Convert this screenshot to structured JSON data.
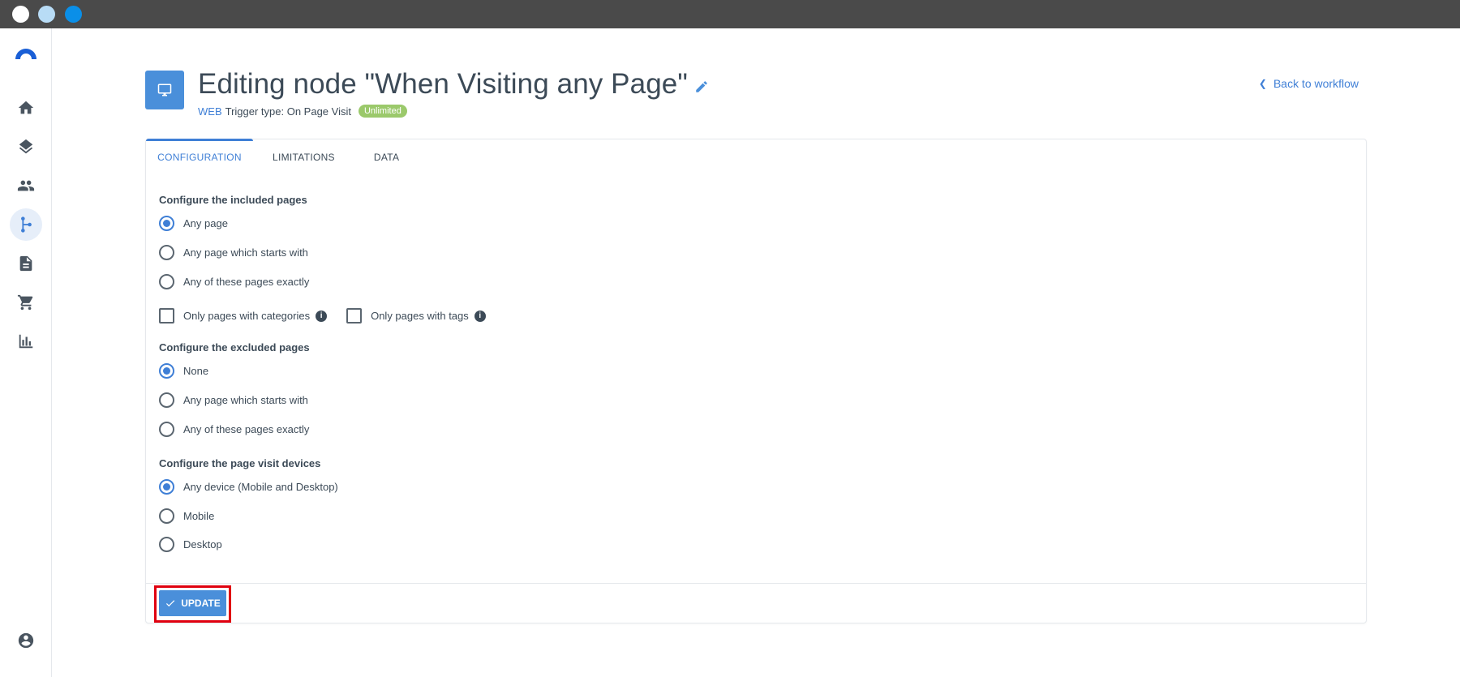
{
  "header": {
    "title": "Editing node \"When Visiting any Page\"",
    "channel": "WEB",
    "trigger_type": "Trigger type: On Page Visit",
    "badge": "Unlimited",
    "back_link": "Back to workflow"
  },
  "tabs": [
    {
      "label": "CONFIGURATION",
      "active": true
    },
    {
      "label": "LIMITATIONS",
      "active": false
    },
    {
      "label": "DATA",
      "active": false
    }
  ],
  "included": {
    "title": "Configure the included pages",
    "options": [
      "Any page",
      "Any page which starts with",
      "Any of these pages exactly"
    ],
    "selected": "Any page",
    "checkbox_categories": "Only pages with categories",
    "checkbox_tags": "Only pages with tags"
  },
  "excluded": {
    "title": "Configure the excluded pages",
    "options": [
      "None",
      "Any page which starts with",
      "Any of these pages exactly"
    ],
    "selected": "None"
  },
  "devices": {
    "title": "Configure the page visit devices",
    "options": [
      "Any device (Mobile and Desktop)",
      "Mobile",
      "Desktop"
    ],
    "selected": "Any device (Mobile and Desktop)"
  },
  "footer": {
    "update_label": "UPDATE"
  },
  "sidebar": {
    "items": [
      "home-icon",
      "layers-icon",
      "people-icon",
      "workflow-icon",
      "document-icon",
      "cart-icon",
      "chart-icon",
      "account-icon"
    ],
    "active": "workflow-icon"
  },
  "colors": {
    "accent": "#3f7fd6",
    "badge": "#9bc96b",
    "highlight": "#e0000f",
    "chrome": "#4a4a4a"
  }
}
